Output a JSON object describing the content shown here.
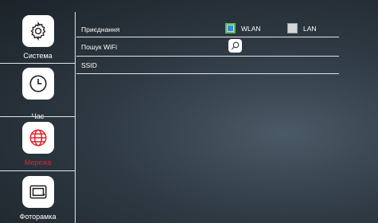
{
  "sidebar": {
    "items": [
      {
        "label": "Система",
        "icon": "gear-icon"
      },
      {
        "label": "Час",
        "icon": "clock-icon"
      },
      {
        "label": "Мережа",
        "icon": "globe-icon",
        "active": true
      },
      {
        "label": "Фоторамка",
        "icon": "picture-frame-icon"
      }
    ]
  },
  "settings": {
    "connection_label": "Приєднання",
    "wlan_label": "WLAN",
    "lan_label": "LAN",
    "wlan_checked": true,
    "lan_checked": false,
    "wifi_search_label": "Пошук WiFi",
    "ssid_label": "SSID"
  },
  "colors": {
    "active_accent": "#e0242a",
    "checkbox_fill": "#2f8fd8"
  }
}
